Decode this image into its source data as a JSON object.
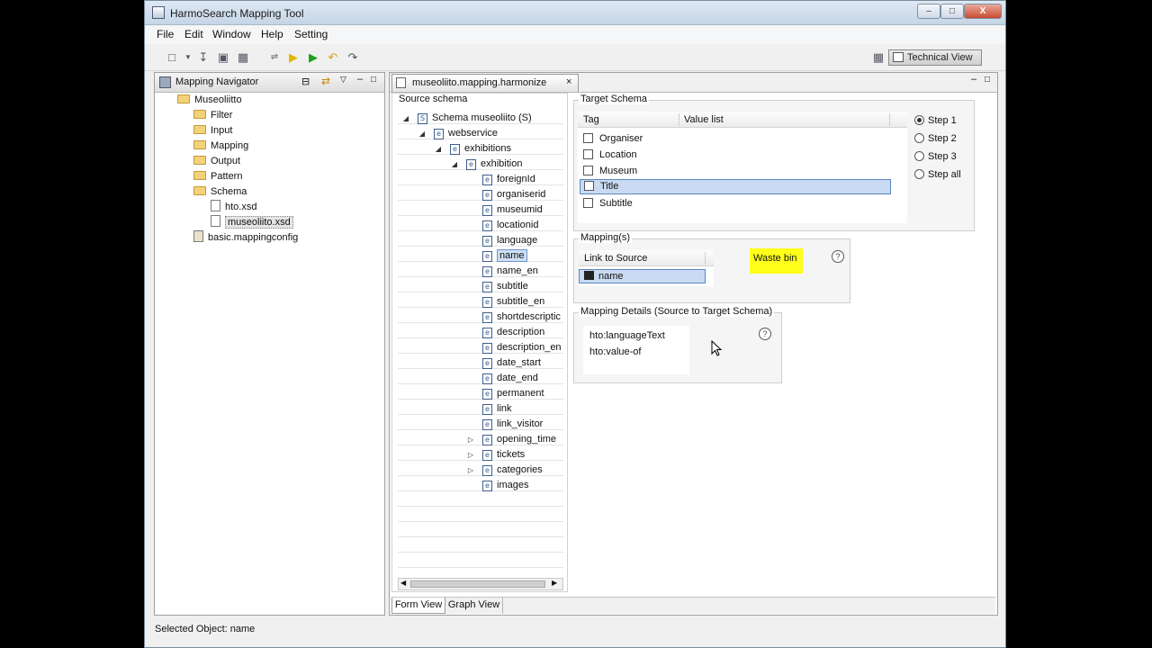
{
  "window": {
    "title": "HarmoSearch Mapping Tool",
    "min": "–",
    "max": "□",
    "close": "X"
  },
  "menu": [
    "File",
    "Edit",
    "Window",
    "Help",
    "Setting"
  ],
  "toolbar": {
    "technical_view": "Technical View"
  },
  "navigator": {
    "title": "Mapping Navigator",
    "root": "Museoliitto",
    "folders": [
      "Filter",
      "Input",
      "Mapping",
      "Output",
      "Pattern",
      "Schema"
    ],
    "schema_files": [
      "hto.xsd",
      "museoliito.xsd"
    ],
    "config": "basic.mappingconfig"
  },
  "editor": {
    "tab": "museoliito.mapping.harmonize",
    "source": {
      "title": "Source schema",
      "root": "Schema museoliito (S)",
      "root_icon": "S",
      "element_icon": "e",
      "nodes": [
        "webservice",
        "exhibitions",
        "exhibition"
      ],
      "leaves": [
        "foreignId",
        "organiserid",
        "museumid",
        "locationid",
        "language",
        "name",
        "name_en",
        "subtitle",
        "subtitle_en",
        "shortdescriptic",
        "description",
        "description_en",
        "date_start",
        "date_end",
        "permanent",
        "link",
        "link_visitor",
        "opening_time",
        "tickets",
        "categories",
        "images"
      ]
    },
    "target": {
      "title": "Target Schema",
      "col_tag": "Tag",
      "col_value": "Value list",
      "tags": [
        "Organiser",
        "Location",
        "Museum",
        "Title",
        "Subtitle"
      ],
      "steps": [
        "Step 1",
        "Step 2",
        "Step 3",
        "Step all"
      ]
    },
    "mappings": {
      "title": "Mapping(s)",
      "col_link": "Link to Source",
      "item": "name",
      "waste_bin": "Waste bin",
      "help": "?"
    },
    "details": {
      "title": "Mapping Details (Source to Target Schema)",
      "lines": [
        "hto:languageText",
        "hto:value-of"
      ],
      "help": "?"
    },
    "tabs": [
      "Form View",
      "Graph View"
    ]
  },
  "status": {
    "text": "Selected Object: name"
  }
}
